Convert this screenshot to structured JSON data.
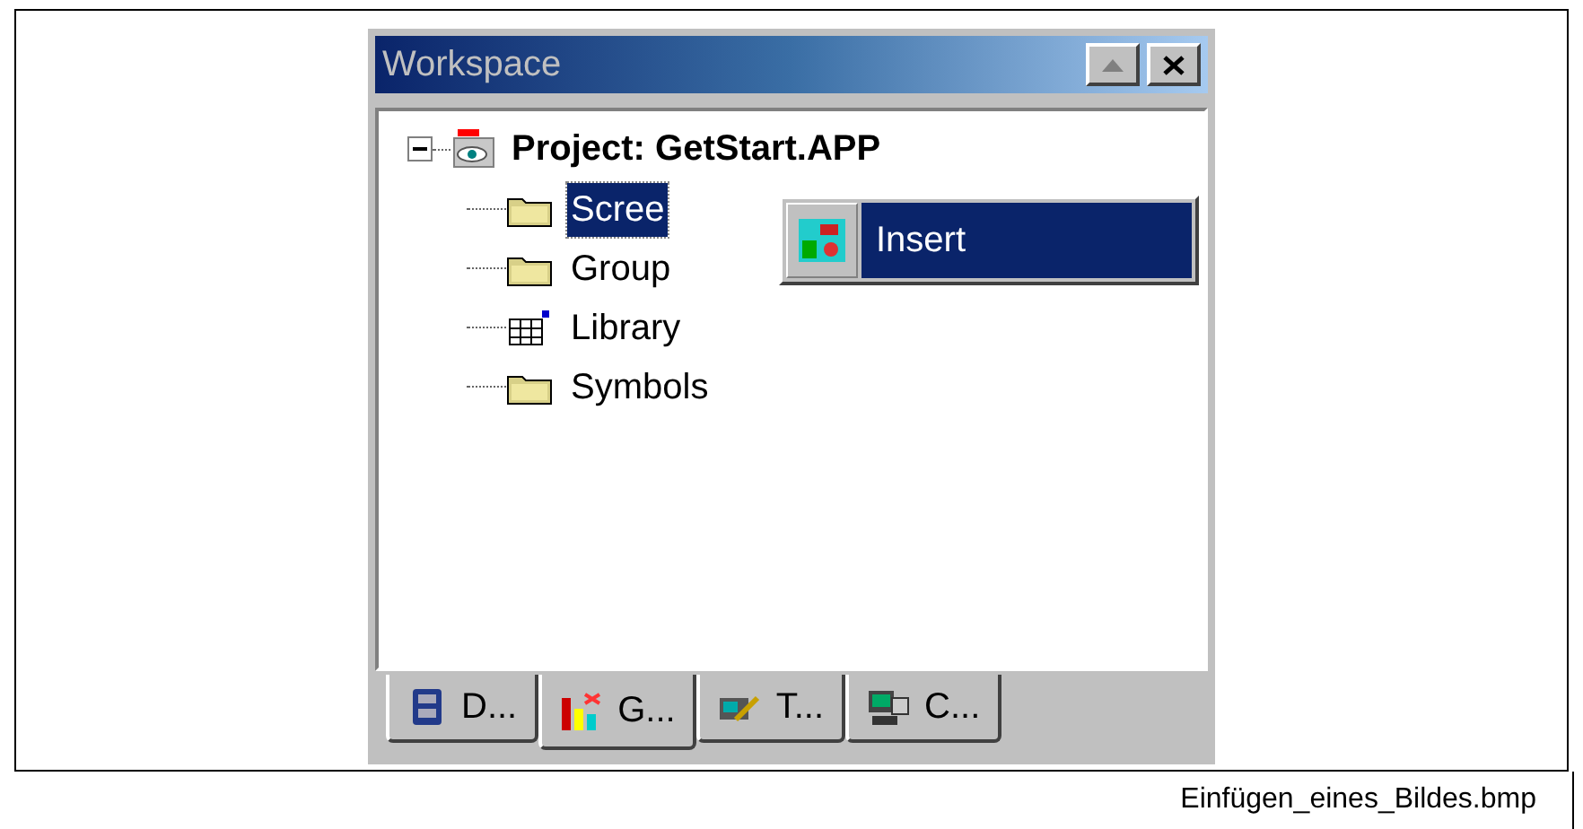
{
  "window": {
    "title": "Workspace"
  },
  "tree": [
    {
      "label": "Project: GetStart.APP",
      "kind": "project",
      "expanded": true,
      "children": [
        {
          "label": "Scree",
          "kind": "folder",
          "selected": true
        },
        {
          "label": "Group",
          "kind": "folder",
          "selected": false
        },
        {
          "label": "Library",
          "kind": "library",
          "selected": false
        },
        {
          "label": "Symbols",
          "kind": "folder",
          "selected": false
        }
      ]
    }
  ],
  "context_menu": {
    "items": [
      {
        "label": "Insert",
        "selected": true
      }
    ]
  },
  "tabs": [
    {
      "label": "D...",
      "kind": "database",
      "selected": false
    },
    {
      "label": "G...",
      "kind": "chart",
      "selected": true
    },
    {
      "label": "T...",
      "kind": "text",
      "selected": false
    },
    {
      "label": "C...",
      "kind": "computer",
      "selected": false
    }
  ],
  "caption": "Einfügen_eines_Bildes.bmp"
}
